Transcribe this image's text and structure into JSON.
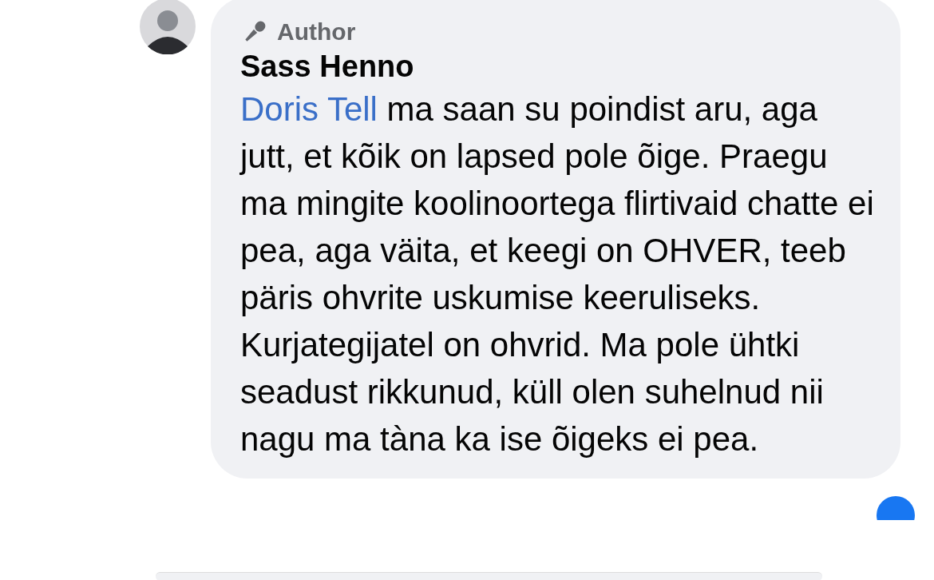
{
  "comment": {
    "badge": "Author",
    "author": "Sass Henno",
    "mention": "Doris Tell",
    "text": " ma saan su poindist aru, aga jutt, et kõik on lapsed pole õige. Praegu ma mingite koolinoortega flirtivaid chatte ei pea, aga väita, et keegi on OHVER, teeb päris ohvrite uskumise keeruliseks. Kurjategijatel on ohvrid. Ma pole ühtki seadust rikkunud, küll olen suhelnud nii nagu ma tàna ka ise õigeks ei pea."
  }
}
